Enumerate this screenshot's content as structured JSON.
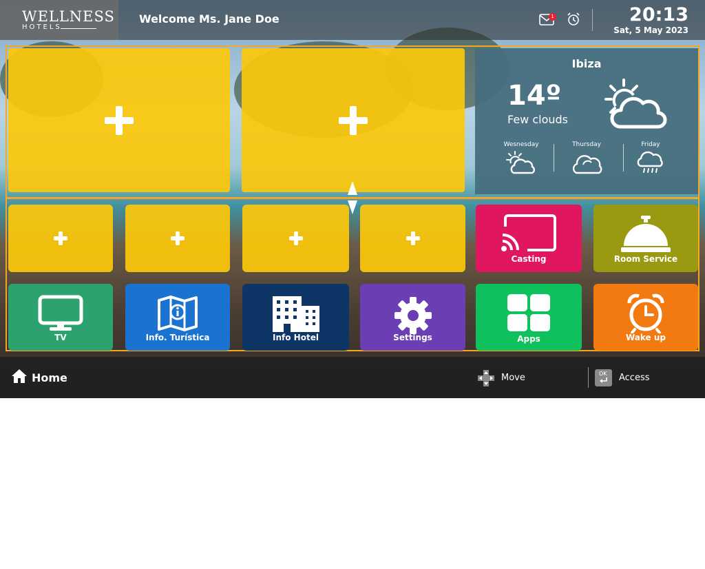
{
  "header": {
    "logo_line1": "WELLNESS",
    "logo_line2": "HOTELS",
    "welcome": "Welcome Ms. Jane Doe",
    "mail_badge": "1",
    "time": "20:13",
    "date": "Sat, 5 May 2023"
  },
  "weather": {
    "city": "Ibiza",
    "temperature": "14º",
    "description": "Few clouds",
    "forecast": [
      {
        "day": "Wesnesday",
        "icon": "sun-cloud-icon"
      },
      {
        "day": "Thursday",
        "icon": "cloud-icon"
      },
      {
        "day": "Friday",
        "icon": "rain-cloud-icon"
      }
    ]
  },
  "tiles": {
    "casting": "Casting",
    "room_service": "Room Service",
    "tv": "TV",
    "info_turistica": "Info. Turística",
    "info_hotel": "Info Hotel",
    "settings": "Settings",
    "apps": "Apps",
    "wake_up": "Wake up"
  },
  "footer": {
    "home": "Home",
    "move": "Move",
    "ok_key": "OK",
    "access": "Access"
  },
  "colors": {
    "frame": "#f5a623",
    "empty_tile": "#fcc80a",
    "casting": "#e0165e",
    "room_service": "#9a9a12",
    "tv": "#2ca36f",
    "info_turistica": "#1a73d1",
    "info_hotel": "#0d3566",
    "settings": "#6b3fb3",
    "apps": "#0fc15d",
    "wake_up": "#f27a10"
  }
}
